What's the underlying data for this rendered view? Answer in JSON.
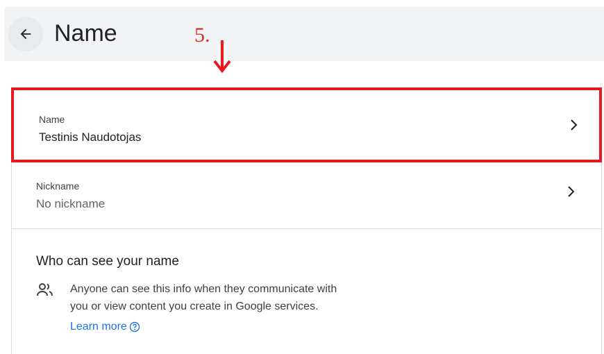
{
  "header": {
    "title": "Name"
  },
  "annotation": {
    "number": "5."
  },
  "rows": [
    {
      "label": "Name",
      "value": "Testinis Naudotojas"
    },
    {
      "label": "Nickname",
      "value": "No nickname"
    }
  ],
  "visibility": {
    "title": "Who can see your name",
    "line1": "Anyone can see this info when they communicate with",
    "line2": "you or view content you create in Google services.",
    "learn_more": "Learn more"
  },
  "colors": {
    "highlight": "#e8191f",
    "link": "#1a73e8",
    "header_bg": "#f1f3f4"
  },
  "icons": [
    "back-arrow-icon",
    "chevron-right-icon",
    "people-icon",
    "help-circle-icon",
    "down-arrow-icon"
  ]
}
